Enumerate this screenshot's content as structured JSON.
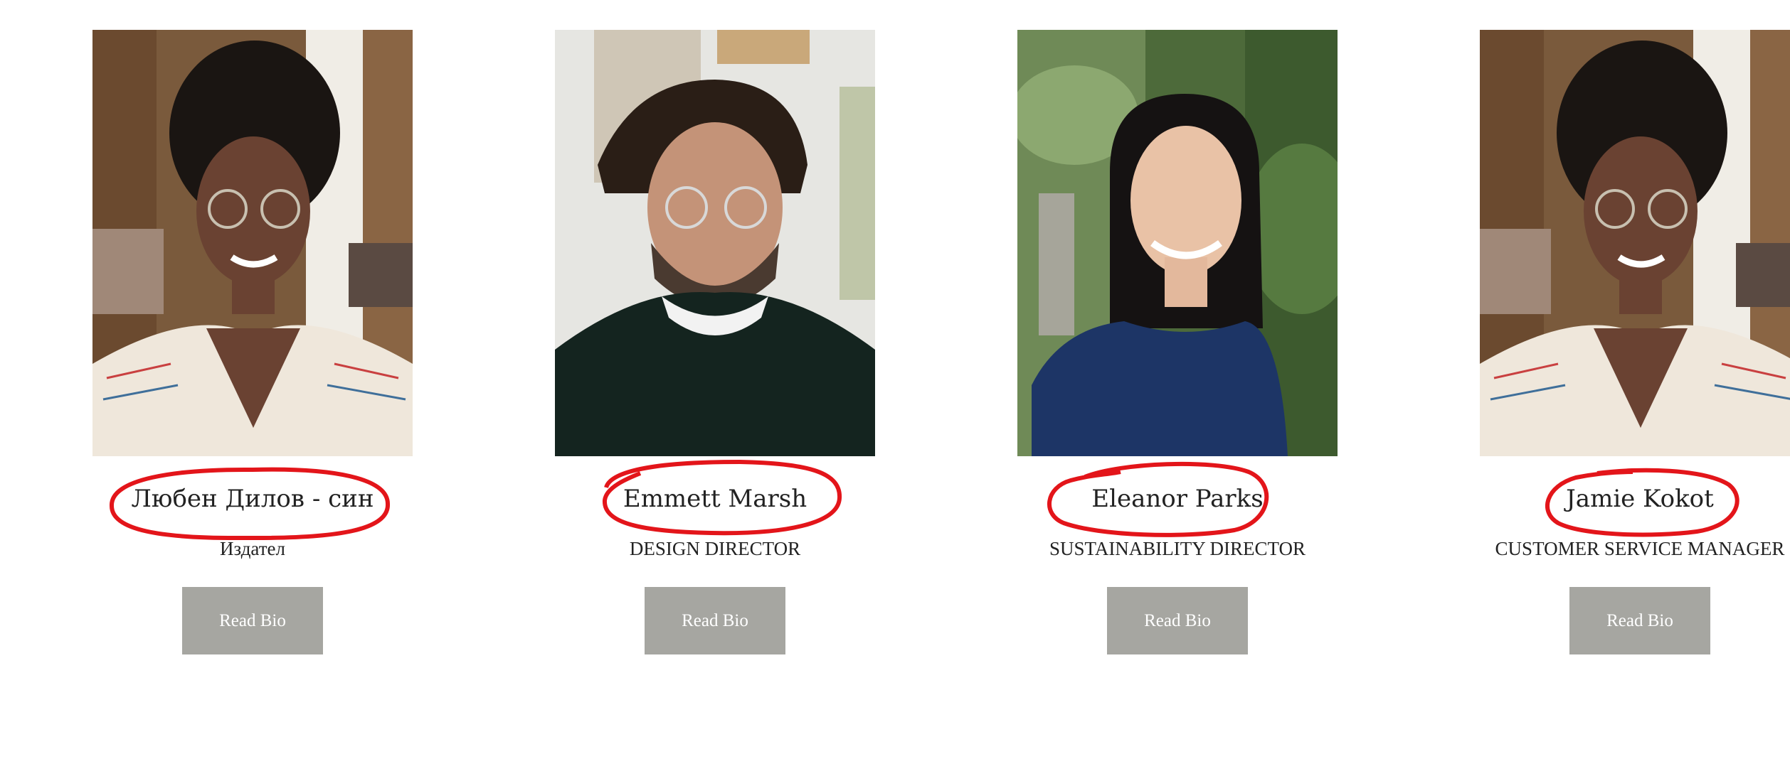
{
  "team": {
    "members": [
      {
        "name": "Любен Дилов - син",
        "role": "Издател",
        "button_label": "Read Bio"
      },
      {
        "name": "Emmett Marsh",
        "role": "DESIGN DIRECTOR",
        "button_label": "Read Bio"
      },
      {
        "name": "Eleanor Parks",
        "role": "SUSTAINABILITY DIRECTOR",
        "button_label": "Read Bio"
      },
      {
        "name": "Jamie Kokot",
        "role": "CUSTOMER SERVICE MANAGER",
        "button_label": "Read Bio"
      }
    ]
  },
  "colors": {
    "button_bg": "#a6a6a1",
    "annotation_red": "#e3151a",
    "text": "#222222"
  }
}
